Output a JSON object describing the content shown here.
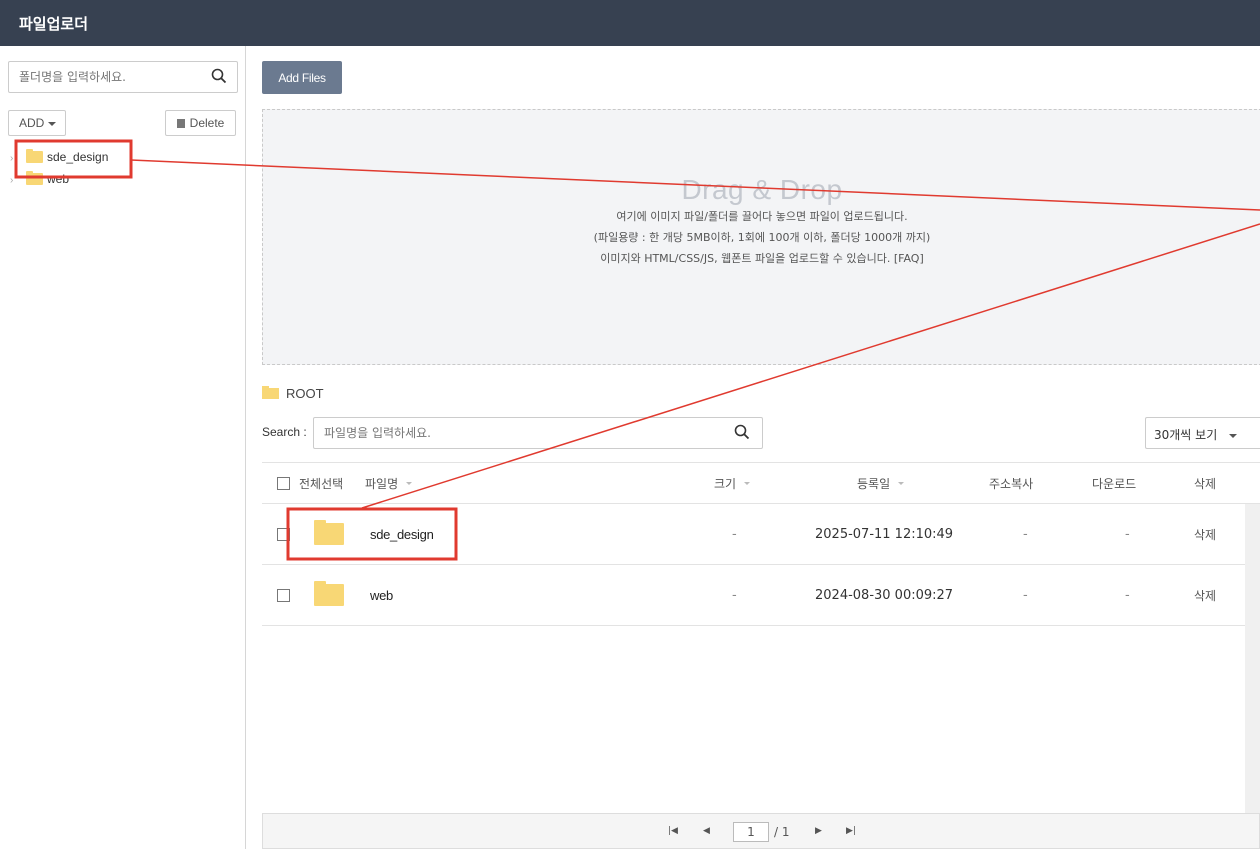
{
  "app": {
    "title": "파일업로더"
  },
  "sidebar": {
    "search_placeholder": "폴더명을 입력하세요.",
    "add_label": "ADD",
    "delete_label": "Delete",
    "tree": [
      {
        "label": "sde_design"
      },
      {
        "label": "web"
      }
    ]
  },
  "main": {
    "add_files_label": "Add Files",
    "dropzone": {
      "title": "Drag & Drop",
      "lines": [
        "여기에 이미지 파일/폴더를 끌어다 놓으면 파일이 업로드됩니다.",
        "(파일용량 : 한 개당 5MB이하, 1회에 100개 이하, 폴더당 1000개 까지)",
        "이미지와 HTML/CSS/JS, 웹폰트 파일을 업로드할 수 있습니다. [FAQ]"
      ]
    },
    "path": "ROOT",
    "search_label": "Search :",
    "search_placeholder": "파일명을 입력하세요.",
    "per_page": "30개씩 보기",
    "table": {
      "headers": {
        "select_all": "전체선택",
        "name": "파일명",
        "size": "크기",
        "date": "등록일",
        "copy_address": "주소복사",
        "download": "다운로드",
        "delete": "삭제"
      },
      "rows": [
        {
          "name": "sde_design",
          "size": "-",
          "date": "2025-07-11 12:10:49",
          "copy": "-",
          "download": "-",
          "delete": "삭제"
        },
        {
          "name": "web",
          "size": "-",
          "date": "2024-08-30 00:09:27",
          "copy": "-",
          "download": "-",
          "delete": "삭제"
        }
      ]
    },
    "pagination": {
      "current": "1",
      "total": "/ 1"
    }
  },
  "colors": {
    "topbar": "#374151",
    "add_files_button": "#6b7a90",
    "folder": "#f8d775",
    "annotation": "#e03a2f"
  }
}
